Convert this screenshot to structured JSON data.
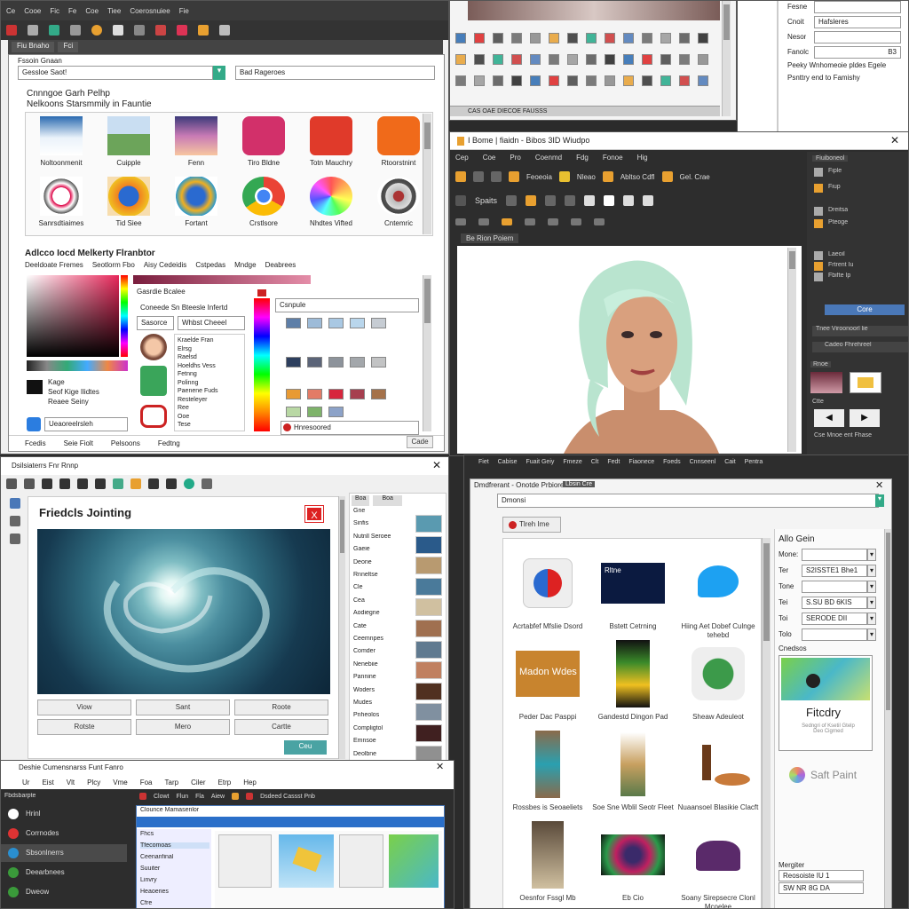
{
  "w1": {
    "menu": [
      "Ce",
      "Cooe",
      "Fic",
      "Fe",
      "Coe",
      "Tiee",
      "Coerosnuiee",
      "Fie"
    ],
    "tabs": [
      "Fiu Bnaho",
      "Fci"
    ],
    "search_label": "Fssoin Gnaan",
    "search_value": "Gessloe Saot!",
    "search2_value": "Bad Rageroes",
    "gallery_title": "Cnnngoe Garh Pelhp",
    "gallery_sub": "Nelkoons Starsmmily in Fauntie",
    "apps": [
      {
        "label": "Noltoonmenit",
        "icon": "clouds"
      },
      {
        "label": "Cuipple",
        "icon": "landscape"
      },
      {
        "label": "Fenn",
        "icon": "sunset"
      },
      {
        "label": "Tiro Bldne",
        "icon": "heart-logo"
      },
      {
        "label": "Totn Mauchry",
        "icon": "r-logo"
      },
      {
        "label": "Rtoorstnint",
        "icon": "wave-logo"
      },
      {
        "label": "Sanrsdtiaimes",
        "icon": "mascot"
      },
      {
        "label": "Tid Siee",
        "icon": "firefox-logo"
      },
      {
        "label": "Fortant",
        "icon": "swirl-logo"
      },
      {
        "label": "Crstlsore",
        "icon": "chrome-logo"
      },
      {
        "label": "Nhdtes Vifted",
        "icon": "color-wheel"
      },
      {
        "label": "Cntemric",
        "icon": "disc-logo"
      }
    ],
    "picker_title": "Adlcco Iocd Melkerty Flranbtor",
    "picker_tabs": [
      "Deeldoate Fremes",
      "Seotlorm Fbo",
      "Aisy Cedeidis",
      "Cstpedas",
      "Mndge",
      "Deabrees"
    ],
    "picker_fields": [
      "Gasrdie Bcalee",
      "Coneede Sn Bteesle Infertd",
      "Sasorce",
      "Whbst Cheeel"
    ],
    "picker_list": [
      "Kraelde Fran",
      "Elrsg",
      "Raelsd",
      "Hoeldhs Vess",
      "Fetnng",
      "Polinng",
      "Paenene Fuds",
      "Resteleyer",
      "Ree",
      "Ooe",
      "Tese"
    ],
    "picker_left": [
      "Kage",
      "Seof Kige Ilidtes",
      "Reaee Seiny",
      "Ueaoreelrsleh"
    ],
    "tint_dropdown": "Csnpule",
    "bottom_input": "Hnresoored",
    "footer": [
      "Fcedis",
      "Seie Fiolt",
      "Pelsoons",
      "Fedtng"
    ],
    "footer_btn": "Cade",
    "colors": {
      "row1": [
        "#5e7fa8",
        "#9dbbd8",
        "#a9c8e3",
        "#b9d6ec",
        "#c6ccd3"
      ],
      "row2": [
        "#2d3f5e",
        "#5b6478",
        "#8d939b",
        "#a3a7ab",
        "#c2c3c4"
      ],
      "row3": [
        "#e89a33",
        "#e37b66",
        "#d7263d",
        "#a63f4f",
        "#a5724a"
      ],
      "row4": [
        "#b9d8a4",
        "#7eb36a",
        "#8ca2c8"
      ]
    }
  },
  "w2": {
    "toolbar_labels": [
      "CAS OAE DIECOE FAUSSS"
    ]
  },
  "w3": {
    "fields": [
      {
        "label": "Fesne",
        "value": ""
      },
      {
        "label": "Cnoit",
        "value": "Hafsleres"
      },
      {
        "label": "Nesor",
        "value": ""
      },
      {
        "label": "Fanolc",
        "value": "B3"
      }
    ],
    "text1": "Peeky Wnhomeoie pldes Egele",
    "text2": "Psnttry end to Famishy"
  },
  "w4": {
    "title": "I Bome | fiaidn - Bibos 3ID Wiudpo",
    "menu": [
      "Cep",
      "Coe",
      "Pro",
      "Coenmd",
      "Fdg",
      "Fonoe",
      "Hig"
    ],
    "toolbar": [
      "Feoeoia",
      "Nleao",
      "Abltso Cdfl",
      "Gel. Crae"
    ],
    "tool2": "Spaits",
    "tab": "Be Rion Poiem",
    "panel_title": "Fiuiboneol",
    "panel_items": [
      "Fiple",
      "Fiup",
      "Dreitsa",
      "Pteoge",
      "Laeoil",
      "Frtrent Iu",
      "Fbifte Ip"
    ],
    "panel_btn": "Core",
    "panel_row": "Tnee Viroonoorl lie",
    "panel_row2": "Cadeo Fhrehreel",
    "panel_label": "Rnoe",
    "panel_label2": "Ctte",
    "panel_bottom": "Cse Mnoe ent Fhase"
  },
  "w5": {
    "title": "Dsilsiaterrs Fnr Rnnp",
    "heading": "Friedcls Jointing",
    "buttons": [
      "Viow",
      "Sant",
      "Roote",
      "Rotste",
      "Mero",
      "Cartte"
    ],
    "ok_btn": "Ceu",
    "tabs": [
      "Boa",
      "Boa"
    ],
    "list": [
      "Gne",
      "Sinfis",
      "Nutnll Seroee",
      "Gaeie",
      "Deone",
      "Rnneltse",
      "Cle",
      "Cea",
      "Aodiegne",
      "Cate",
      "Ceemnpes",
      "Comder",
      "Nenebiie",
      "Pannine",
      "Woders",
      "Mudes",
      "Pnheolos",
      "Compligtol",
      "Emnsoe",
      "Deolbne"
    ]
  },
  "w6": {
    "menu": [
      "Fiet",
      "Cabise",
      "Fuait Geiy",
      "Fmeze",
      "Clt",
      "Fedt",
      "Fiaonece",
      "Foeds",
      "Cnnseenl",
      "Cait",
      "Pentra"
    ],
    "title": "Dmdfrerant - Onotde Prbiores",
    "search_tab": "Lbsin Cre",
    "search_value": "Dmonsi",
    "filter_btn": "Tlreh Ime",
    "items": [
      {
        "label": "Acrtabfef Mfslie Dsord",
        "art": "globe"
      },
      {
        "label": "Bstett Cetrning",
        "art": "dark-card"
      },
      {
        "label": "Hiing Aet Dobef Culnge tehebd",
        "art": "bird"
      },
      {
        "label": "Peder Dac Pasppi",
        "art": "madon"
      },
      {
        "label": "Gandestd Dingon Pad",
        "art": "poster"
      },
      {
        "label": "Sheaw Adeuleot",
        "art": "orb"
      },
      {
        "label": "Rossbes is Seoaeliets",
        "art": "door"
      },
      {
        "label": "Soe Sne Wblil Seotr Fleet",
        "art": "path"
      },
      {
        "label": "Nuaansoel Blasikie Clacft",
        "art": "drinks"
      },
      {
        "label": "Oesnfor Fssgl Mb",
        "art": "tree"
      },
      {
        "label": "Eb Cio",
        "art": "glow"
      },
      {
        "label": "Soany Sirepsecre Clonl Mcoelee",
        "art": "blob"
      }
    ],
    "madon_text": "Madon Wdes",
    "card_text": "Rltne",
    "side_title": "Allo Gein",
    "side_fields": [
      {
        "label": "Mone:",
        "value": ""
      },
      {
        "label": "Ter",
        "value": "S2ISSTE1 Bhe1"
      },
      {
        "label": "Tone",
        "value": ""
      },
      {
        "label": "Tei",
        "value": "S.SU BD 6KIS"
      },
      {
        "label": "Toi",
        "value": "SERODE DII"
      },
      {
        "label": "Tolo",
        "value": ""
      }
    ],
    "side_sub": "Cnedsos",
    "side_card_title": "Fitcdry",
    "side_card_sub": "Sedngri of Ksetil Gtelp Deo Cigrned",
    "logo_text": "Saft Paint",
    "side_bottom": "Mergiter",
    "side_fields2": [
      {
        "label": "",
        "value": "Reosoiste IU 1"
      },
      {
        "label": "",
        "value": "SW NR 8G DA"
      }
    ]
  },
  "w7": {
    "title": "Deshie Cumensnarss Funt Fanro",
    "menu": [
      "Ur",
      "Eist",
      "Vlt",
      "Plcy",
      "Vme",
      "Foa",
      "Tarp",
      "Ciler",
      "Etrp",
      "Hep"
    ],
    "side_title": "Fbdsbarpte",
    "side_items": [
      {
        "label": "Hrinl",
        "icon": "home"
      },
      {
        "label": "Corrnodes",
        "icon": "red"
      },
      {
        "label": "Sbsonlnerrs",
        "icon": "blue"
      },
      {
        "label": "Deearbnees",
        "icon": "green"
      },
      {
        "label": "Dweow",
        "icon": "green"
      }
    ],
    "toolbar": [
      "Clowt",
      "Flun",
      "Fla",
      "Aiew",
      "Dsdeed Cassst Pnb"
    ],
    "inner_title": "Clounce Mamasenlor",
    "inner_list": [
      "Fhcs",
      "Tfecomoas",
      "Ceenanfinal",
      "Suuiter",
      "Linvry",
      "Heaoeries",
      "Cfre"
    ]
  }
}
